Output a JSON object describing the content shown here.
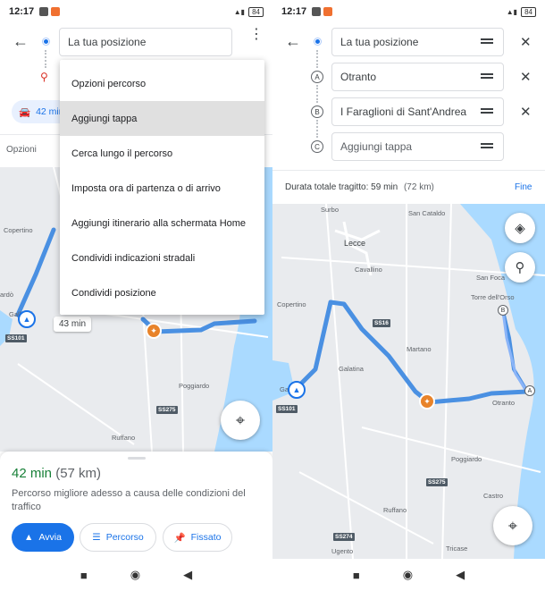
{
  "status": {
    "time": "12:17",
    "battery": "84"
  },
  "left": {
    "search_value": "La tua posizione",
    "mode_chip": "42 min",
    "options_label": "Opzioni",
    "menu": [
      "Opzioni percorso",
      "Aggiungi tappa",
      "Cerca lungo il percorso",
      "Imposta ora di partenza o di arrivo",
      "Aggiungi itinerario alla schermata Home",
      "Condividi indicazioni stradali",
      "Condividi posizione"
    ],
    "map": {
      "towns": [
        "Copertino",
        "ardò",
        "Gallipoli",
        "Poggiardo",
        "Ruffano"
      ],
      "roads": [
        "SS101",
        "SS275"
      ],
      "time_bubble": "43 min"
    },
    "sheet": {
      "duration": "42 min",
      "distance": "(57 km)",
      "description": "Percorso migliore adesso a causa delle condizioni del traffico",
      "start_button": "Avvia",
      "route_button": "Percorso",
      "pin_button": "Fissato"
    }
  },
  "right": {
    "fields": [
      "La tua posizione",
      "Otranto",
      "I Faraglioni di Sant'Andrea",
      "Aggiungi tappa"
    ],
    "letters": [
      "A",
      "B",
      "C"
    ],
    "summary_label": "Durata totale tragitto: 59 min",
    "summary_distance": "(72 km)",
    "done": "Fine",
    "map": {
      "towns": [
        "Surbo",
        "San Cataldo",
        "Lecce",
        "Cavallino",
        "San Foca",
        "Torre dell'Orso",
        "Copertino",
        "Martano",
        "Galatina",
        "Otranto",
        "Gallipoli",
        "Poggiardo",
        "Castro",
        "Ruffano",
        "Tricase",
        "Ugento"
      ],
      "roads": [
        "SS16",
        "SS101",
        "SS275",
        "SS274"
      ]
    }
  },
  "colors": {
    "accent": "#1a73e8",
    "route": "#4a90e2",
    "poi": "#e8832a"
  }
}
